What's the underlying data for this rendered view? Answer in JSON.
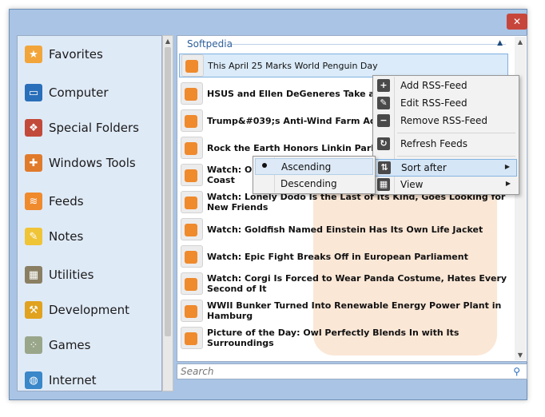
{
  "window": {
    "close_label": "✕"
  },
  "categories": [
    {
      "label": "Favorites",
      "icon": "star-icon",
      "color": "#f2a53a",
      "glyph": "★"
    },
    {
      "label": "Computer",
      "icon": "monitor-icon",
      "color": "#2a6fb9",
      "glyph": "▭"
    },
    {
      "label": "Special Folders",
      "icon": "windows-logo-icon",
      "color": "#c24a3a",
      "glyph": "❖"
    },
    {
      "label": "Windows Tools",
      "icon": "tools-icon",
      "color": "#e07b2c",
      "glyph": "✚"
    },
    {
      "label": "Feeds",
      "icon": "rss-icon",
      "color": "#ef8a2d",
      "glyph": "≋"
    },
    {
      "label": "Notes",
      "icon": "notes-icon",
      "color": "#f0c437",
      "glyph": "✎"
    },
    {
      "label": "Utilities",
      "icon": "calculator-icon",
      "color": "#8a7f63",
      "glyph": "▦"
    },
    {
      "label": "Development",
      "icon": "construction-icon",
      "color": "#e0a21f",
      "glyph": "⚒"
    },
    {
      "label": "Games",
      "icon": "dice-icon",
      "color": "#9aa68a",
      "glyph": "⁘"
    },
    {
      "label": "Internet",
      "icon": "globe-icon",
      "color": "#3a87c9",
      "glyph": "◍"
    }
  ],
  "feed": {
    "header": "Softpedia",
    "collapse_glyph": "▲",
    "items": [
      {
        "title": "This April 25 Marks World Penguin Day"
      },
      {
        "title": "HSUS and Ellen DeGeneres Take a Stand"
      },
      {
        "title": "Trump&#039;s Anti-Wind Farm Ad Ban"
      },
      {
        "title": "Rock the Earth Honors Linkin Park, Their"
      },
      {
        "title": "Watch: Orc ... Coast"
      },
      {
        "title": "Watch: Lonely Dodo Is the Last of Its Kind, Goes Looking for New Friends"
      },
      {
        "title": "Watch: Goldfish Named Einstein Has Its Own Life Jacket"
      },
      {
        "title": "Watch: Epic Fight Breaks Off in European Parliament"
      },
      {
        "title": "Watch: Corgi Is Forced to Wear Panda Costume, Hates Every Second of It"
      },
      {
        "title": "WWII Bunker Turned Into Renewable Energy Power Plant in Hamburg"
      },
      {
        "title": "Picture of the Day: Owl Perfectly Blends In with Its Surroundings"
      }
    ],
    "item5_line1": "Watch: Orc",
    "item5_line2": "Coast"
  },
  "search": {
    "placeholder": "Search",
    "icon": "search-icon"
  },
  "context_menu": {
    "items": [
      {
        "label": "Add RSS-Feed",
        "icon": "plus-icon",
        "glyph": "+"
      },
      {
        "label": "Edit RSS-Feed",
        "icon": "pencil-icon",
        "glyph": "✎"
      },
      {
        "label": "Remove RSS-Feed",
        "icon": "minus-icon",
        "glyph": "−"
      },
      {
        "label": "Refresh Feeds",
        "icon": "refresh-icon",
        "glyph": "↻"
      },
      {
        "label": "Sort after",
        "icon": "sort-icon",
        "glyph": "⇅"
      },
      {
        "label": "View",
        "icon": "grid-view-icon",
        "glyph": "▦"
      }
    ],
    "submenu_arrow": "▶"
  },
  "sort_submenu": {
    "items": [
      {
        "label": "Ascending",
        "checked": true
      },
      {
        "label": "Descending",
        "checked": false
      }
    ]
  }
}
